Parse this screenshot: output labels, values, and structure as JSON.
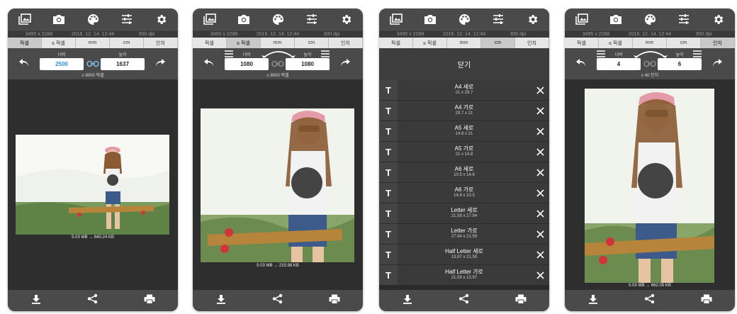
{
  "top_icons": [
    "gallery-icon",
    "camera-icon",
    "palette-icon",
    "sliders-icon",
    "gear-icon"
  ],
  "bottom_icons": [
    "download-icon",
    "share-icon",
    "print-icon"
  ],
  "info": {
    "resolution": "3495 x 2288",
    "date": "2016. 12. 14. 12:44",
    "dpi": "300 dpi"
  },
  "units": [
    "픽셀",
    "≤ 픽셀",
    "mm",
    "cm",
    "인치"
  ],
  "screens": [
    {
      "selected_unit": 0,
      "width_label": "너비",
      "height_label": "높이",
      "width": "2500",
      "height": "1637",
      "limit": "≤ 8000 픽셀",
      "size_text": "5.03 MB → 640.24 KB"
    },
    {
      "selected_unit": 1,
      "width_label": "너비",
      "height_label": "높이",
      "width": "1080",
      "height": "1080",
      "limit": "≤ 8000 픽셀",
      "size_text": "5.03 MB → 215.98 KB"
    },
    {
      "selected_unit": 3,
      "close_label": "닫기",
      "presets": [
        {
          "name": "A4 세로",
          "dims": "21 x 29.7"
        },
        {
          "name": "A4 가로",
          "dims": "29.7 x 21"
        },
        {
          "name": "A5 세로",
          "dims": "14.8 x 21"
        },
        {
          "name": "A5 가로",
          "dims": "21 x 14.8"
        },
        {
          "name": "A6 세로",
          "dims": "10.5 x 14.8"
        },
        {
          "name": "A6 가로",
          "dims": "14.8 x 10.5"
        },
        {
          "name": "Letter 세로",
          "dims": "21.59 x 27.94"
        },
        {
          "name": "Letter 가로",
          "dims": "27.94 x 21.59"
        },
        {
          "name": "Half Letter 세로",
          "dims": "13.97 x 21.59"
        },
        {
          "name": "Half Letter 가로",
          "dims": "21.59 x 13.97"
        }
      ],
      "preset_icon_letter": "T"
    },
    {
      "selected_unit": 4,
      "width_label": "너비",
      "height_label": "높이",
      "width": "4",
      "height": "6",
      "limit": "≤ 40 인치",
      "size_text": "5.03 MB → 662.05 KB"
    }
  ]
}
